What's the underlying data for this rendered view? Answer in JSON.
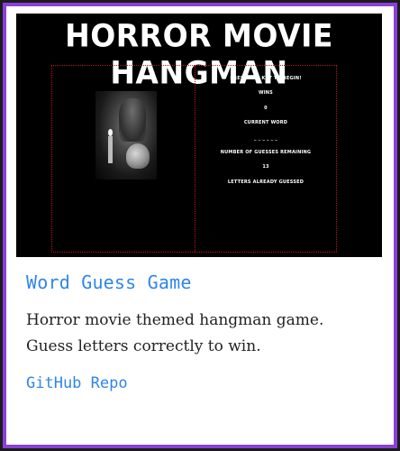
{
  "screenshot": {
    "title": "HORROR MOVIE HANGMAN",
    "poster_icon": "horror-poster-image",
    "info_lines": [
      "PRESS ANY KEY TO BEGIN!",
      "WINS",
      "0",
      "CURRENT WORD",
      "_ _ _ _ _ _",
      "NUMBER OF GUESSES REMAINING",
      "13",
      "LETTERS ALREADY GUESSED"
    ]
  },
  "card": {
    "title": "Word Guess Game",
    "description": "Horror movie themed hangman game. Guess letters correctly to win.",
    "link_label": "GitHub Repo"
  },
  "colors": {
    "border_outer": "#1c1c1c",
    "border_purple": "#8a3fd8",
    "link_blue": "#2f86e8",
    "dotted_red": "#c0141a"
  }
}
